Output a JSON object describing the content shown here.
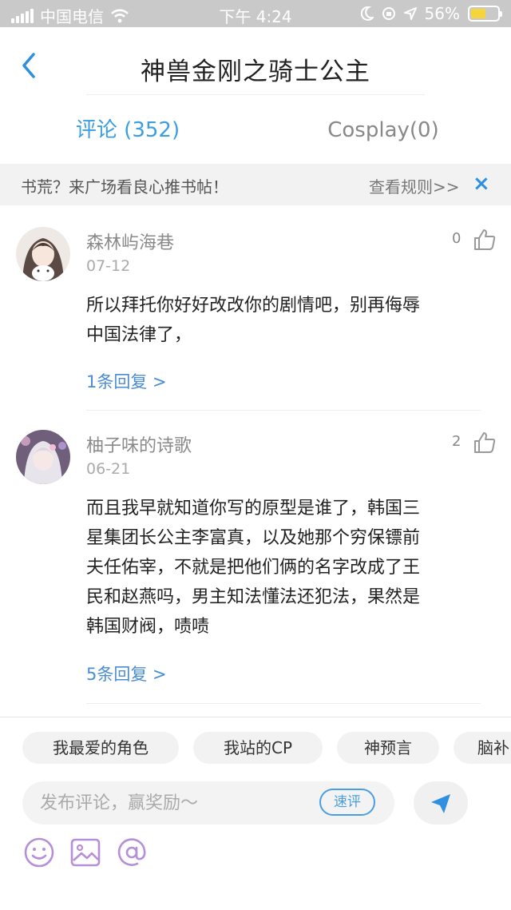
{
  "status_bar": {
    "carrier": "中国电信",
    "time": "下午 4:24",
    "battery": "56%"
  },
  "header": {
    "title": "神兽金刚之骑士公主"
  },
  "tabs": [
    {
      "label": "评论 (352)",
      "active": true
    },
    {
      "label": "Cosplay(0)",
      "active": false
    }
  ],
  "notice": {
    "text": "书荒？来广场看良心推书帖！",
    "link": "查看规则>>",
    "close": "×"
  },
  "comments": [
    {
      "username": "森林屿海巷",
      "date": "07-12",
      "likes": "0",
      "lines": [
        "所以拜托你好好改改你的剧情吧，别再侮辱",
        "中国法律了，"
      ],
      "replies": "1条回复 >"
    },
    {
      "username": "柚子味的诗歌",
      "date": "06-21",
      "likes": "2",
      "lines": [
        "而且我早就知道你写的原型是谁了，韩国三",
        "星集团长公主李富真，以及她那个穷保镖前",
        "夫任佑宰，不就是把他们俩的名字改成了王",
        "民和赵燕吗，男主知法懂法还犯法，果然是",
        "韩国财阀，啧啧"
      ],
      "replies": "5条回复 >"
    }
  ],
  "quick_tags": [
    "我最爱的角色",
    "我站的CP",
    "神预言",
    "脑补"
  ],
  "composer": {
    "placeholder": "发布评论，赢奖励～",
    "quick_review": "速评"
  },
  "colors": {
    "accent": "#3b9ee0",
    "reply_link": "#4a8cd6",
    "icon_purple": "#b58fd8"
  }
}
